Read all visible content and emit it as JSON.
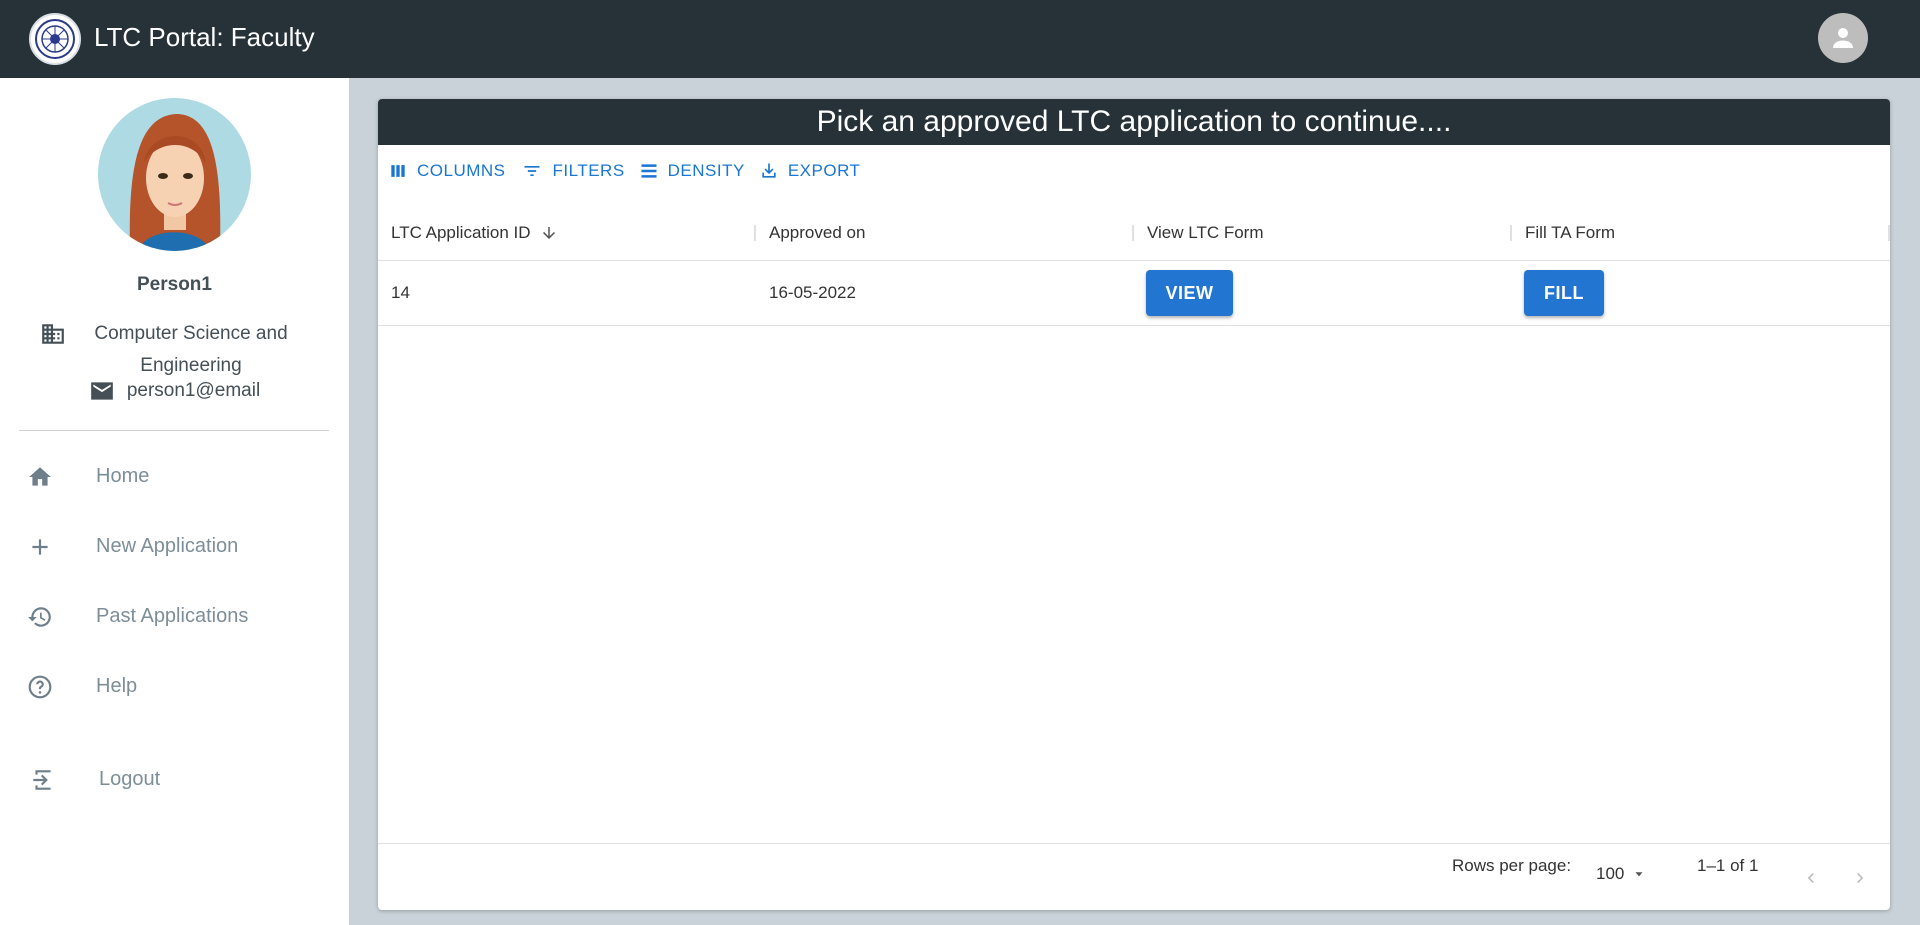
{
  "app": {
    "title": "LTC Portal: Faculty"
  },
  "user": {
    "name": "Person1",
    "department": "Computer Science and Engineering",
    "email": "person1@email"
  },
  "nav": {
    "items": [
      {
        "label": "Home",
        "icon": "home-icon"
      },
      {
        "label": "New Application",
        "icon": "plus-icon"
      },
      {
        "label": "Past Applications",
        "icon": "history-icon"
      },
      {
        "label": "Help",
        "icon": "help-icon"
      },
      {
        "label": "Logout",
        "icon": "logout-icon"
      }
    ]
  },
  "panel": {
    "title": "Pick an approved LTC application to continue...."
  },
  "toolbar": {
    "columns": "COLUMNS",
    "filters": "FILTERS",
    "density": "DENSITY",
    "export": "EXPORT"
  },
  "grid": {
    "columns": [
      "LTC Application ID",
      "Approved on",
      "View LTC Form",
      "Fill TA Form"
    ],
    "sort": {
      "column": "LTC Application ID",
      "direction": "descending"
    },
    "rows": [
      {
        "id": "14",
        "approved_on": "16-05-2022",
        "view_label": "VIEW",
        "fill_label": "FILL"
      }
    ]
  },
  "pagination": {
    "rows_per_page_label": "Rows per page:",
    "rows_per_page": "100",
    "range": "1–1 of 1"
  },
  "colors": {
    "topbar": "#263238",
    "accent": "#1976d2",
    "nav_text": "#7d8e99"
  }
}
